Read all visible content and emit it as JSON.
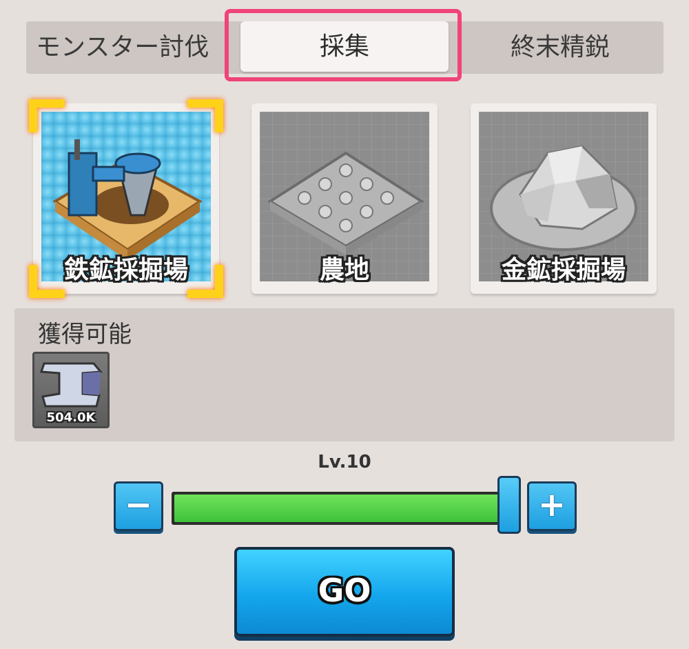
{
  "tabs": [
    {
      "label": "モンスター討伐",
      "active": false
    },
    {
      "label": "採集",
      "active": true
    },
    {
      "label": "終末精鋭",
      "active": false
    }
  ],
  "cards": [
    {
      "label": "鉄鉱採掘場",
      "selected": true,
      "icon": "drill-icon"
    },
    {
      "label": "農地",
      "selected": false,
      "icon": "farmland-icon"
    },
    {
      "label": "金鉱採掘場",
      "selected": false,
      "icon": "gold-rock-icon"
    }
  ],
  "rewards": {
    "title": "獲得可能",
    "items": [
      {
        "icon": "iron-ingot-icon",
        "amount": "504.0K"
      }
    ]
  },
  "level": {
    "text": "Lv.10",
    "minus": "−",
    "plus": "+",
    "fill_fraction": 1.0
  },
  "go_button": {
    "label": "GO"
  },
  "colors": {
    "highlight": "#f0447a",
    "selected_corner": "#ffd21a",
    "button_blue": "#14a6ec",
    "slider_green": "#3fc23a"
  }
}
